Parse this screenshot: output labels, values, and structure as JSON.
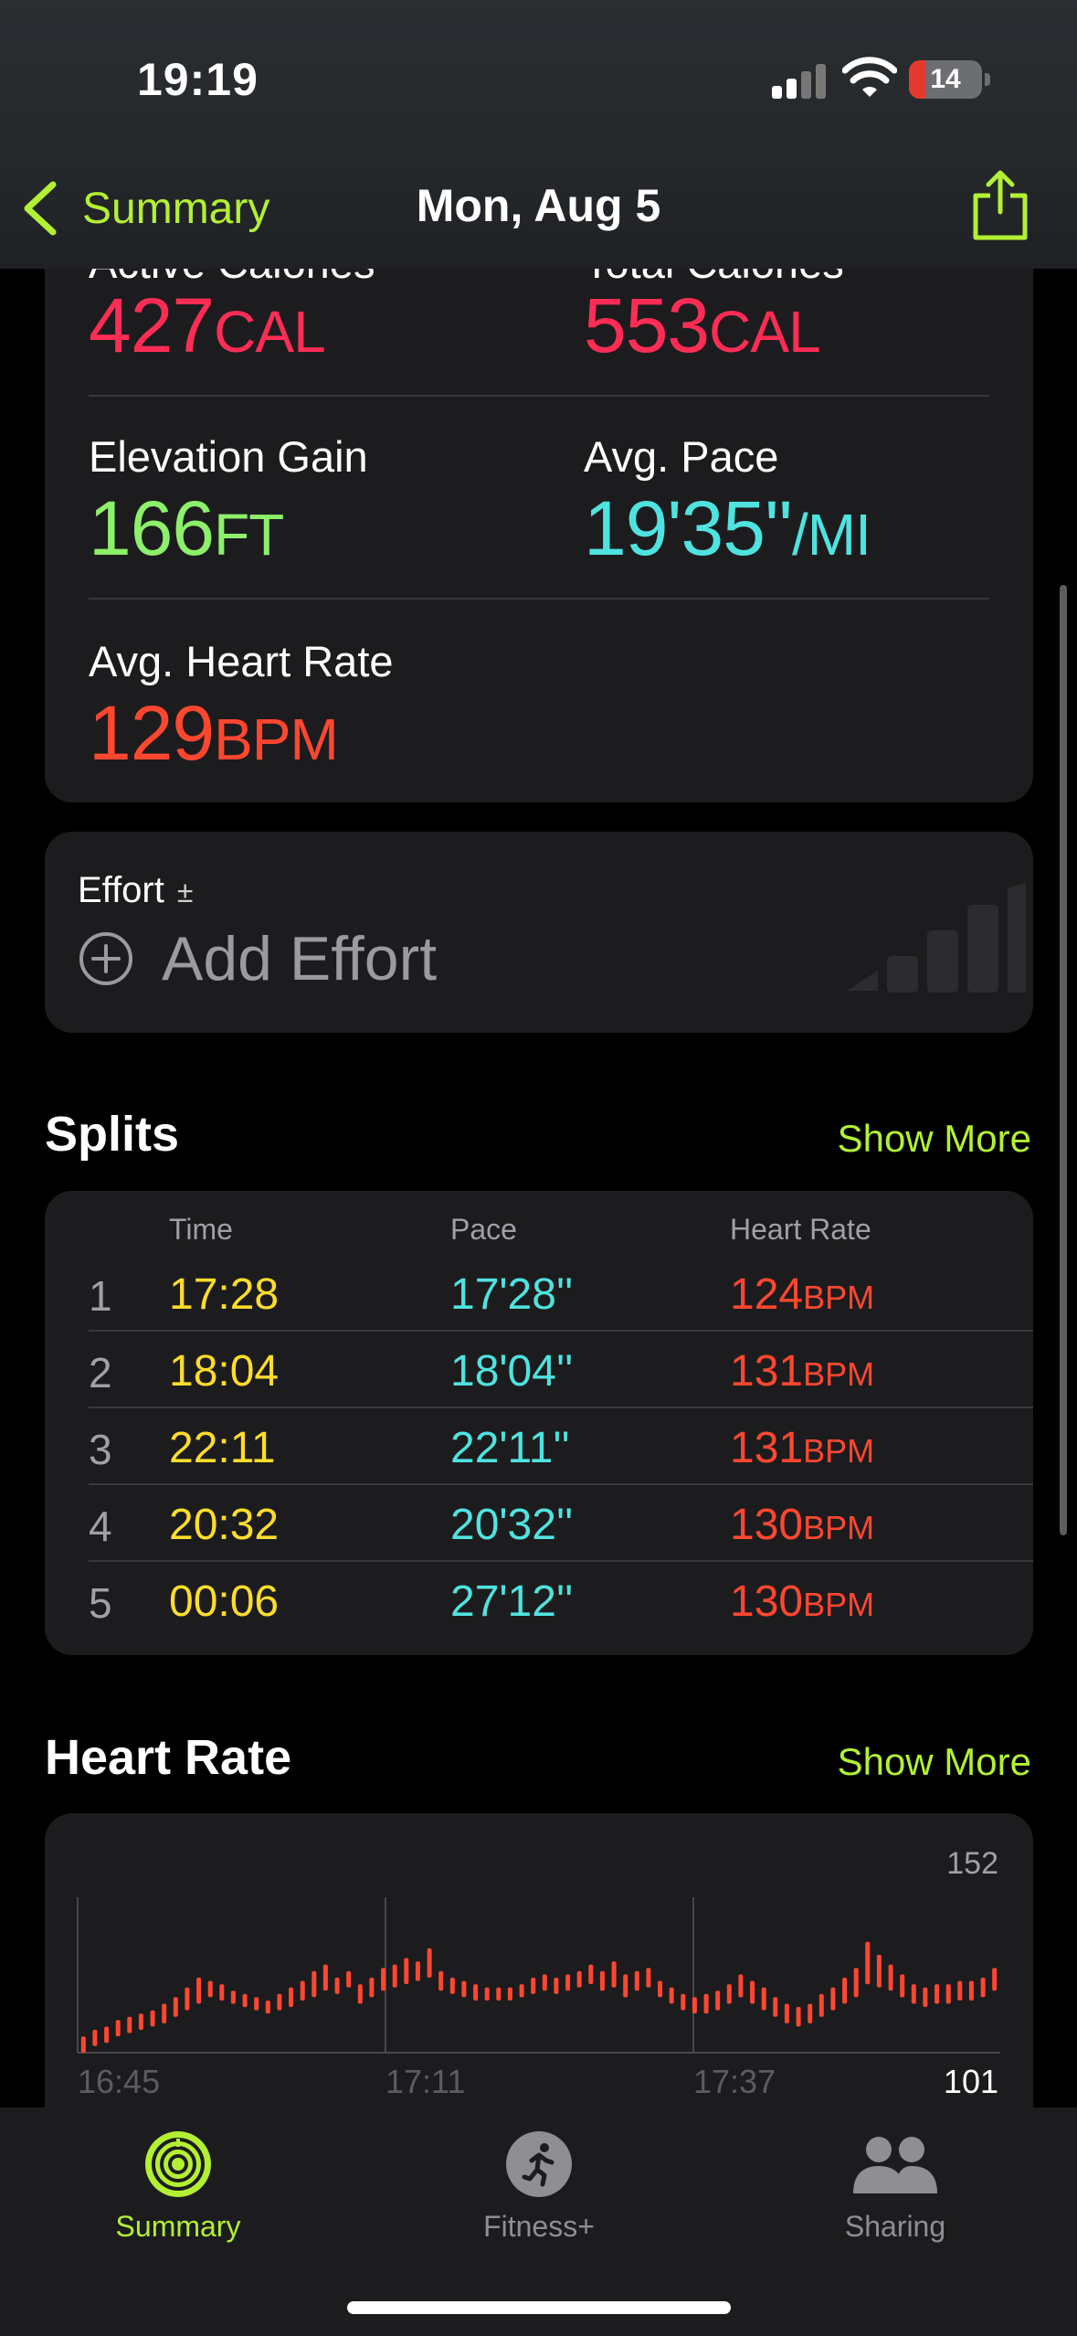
{
  "status_bar": {
    "time": "19:19",
    "battery": "14"
  },
  "nav": {
    "back_label": "Summary",
    "title": "Mon, Aug 5"
  },
  "metrics": {
    "active_calories": {
      "label": "Active Calories",
      "value": "427",
      "unit": "CAL"
    },
    "total_calories": {
      "label": "Total Calories",
      "value": "553",
      "unit": "CAL"
    },
    "elevation_gain": {
      "label": "Elevation Gain",
      "value": "166",
      "unit": "FT"
    },
    "avg_pace": {
      "label": "Avg. Pace",
      "value": "19'35''",
      "unit": "/MI"
    },
    "avg_heart_rate": {
      "label": "Avg. Heart Rate",
      "value": "129",
      "unit": "BPM"
    }
  },
  "effort": {
    "label": "Effort",
    "pm": "±",
    "add_label": "Add Effort"
  },
  "splits": {
    "title": "Splits",
    "show_more": "Show More",
    "columns": [
      "Time",
      "Pace",
      "Heart Rate"
    ],
    "rows": [
      {
        "num": "1",
        "time": "17:28",
        "pace": "17'28''",
        "hr": "124",
        "unit": "BPM"
      },
      {
        "num": "2",
        "time": "18:04",
        "pace": "18'04''",
        "hr": "131",
        "unit": "BPM"
      },
      {
        "num": "3",
        "time": "22:11",
        "pace": "22'11''",
        "hr": "131",
        "unit": "BPM"
      },
      {
        "num": "4",
        "time": "20:32",
        "pace": "20'32''",
        "hr": "130",
        "unit": "BPM"
      },
      {
        "num": "5",
        "time": "00:06",
        "pace": "27'12''",
        "hr": "130",
        "unit": "BPM"
      }
    ]
  },
  "heart_rate": {
    "title": "Heart Rate",
    "show_more": "Show More"
  },
  "chart_data": {
    "type": "bar",
    "title": "",
    "x_ticks": [
      "16:45",
      "17:11",
      "17:37"
    ],
    "y_max_label": "152",
    "y_min_label": "101",
    "ylim": [
      101,
      152
    ],
    "color": "#ff4730",
    "series": [
      {
        "lows": [
          101,
          103,
          104,
          106,
          107,
          108,
          109,
          110,
          112,
          114,
          116,
          118,
          117,
          116,
          115,
          114,
          113,
          114,
          115,
          117,
          118,
          120,
          119,
          121,
          116,
          118,
          120,
          121,
          122,
          123,
          124,
          120,
          119,
          118,
          117,
          117,
          117,
          117,
          118,
          119,
          120,
          119,
          120,
          121,
          122,
          120,
          121,
          118,
          120,
          121,
          118,
          116,
          114,
          113,
          113,
          114,
          116,
          118,
          116,
          114,
          112,
          110,
          109,
          110,
          112,
          114,
          116,
          118,
          122,
          121,
          120,
          118,
          116,
          115,
          116,
          116,
          117,
          117,
          118,
          120
        ],
        "highs": [
          106,
          108,
          109,
          111,
          112,
          113,
          114,
          116,
          118,
          121,
          124,
          123,
          122,
          120,
          119,
          118,
          117,
          119,
          121,
          123,
          126,
          128,
          124,
          126,
          122,
          124,
          127,
          128,
          130,
          129,
          133,
          126,
          124,
          123,
          122,
          121,
          121,
          121,
          122,
          124,
          125,
          124,
          125,
          126,
          128,
          126,
          129,
          125,
          126,
          127,
          123,
          121,
          119,
          118,
          119,
          120,
          122,
          125,
          123,
          121,
          118,
          116,
          115,
          116,
          119,
          121,
          124,
          127,
          135,
          131,
          128,
          125,
          122,
          121,
          122,
          122,
          123,
          123,
          124,
          127
        ]
      }
    ]
  },
  "tabs": [
    {
      "label": "Summary",
      "icon": "activity-rings-icon",
      "active": true
    },
    {
      "label": "Fitness+",
      "icon": "running-figure-icon",
      "active": false
    },
    {
      "label": "Sharing",
      "icon": "people-icon",
      "active": false
    }
  ],
  "colors": {
    "accent": "#b3f033",
    "calories": "#ff2d55",
    "elevation": "#8cf06a",
    "pace": "#4fe3e0",
    "heart": "#ff4730",
    "split_time": "#ffdd2a"
  }
}
